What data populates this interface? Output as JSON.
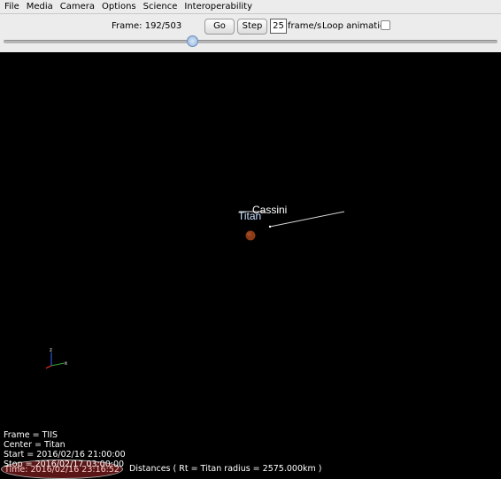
{
  "menu": [
    "File",
    "Media",
    "Camera",
    "Options",
    "Science",
    "Interoperability"
  ],
  "controls": {
    "frame_text": "Frame: 192/503",
    "current_frame": 192,
    "total_frames": 503,
    "go_label": "Go",
    "step_label": "Step",
    "fps_value": "25",
    "fps_label": "frame/s",
    "loop_label": "Loop animation",
    "loop_checked": false
  },
  "scene": {
    "body_label": "Titan",
    "spacecraft_label": "Cassini",
    "body_color": "#8a3a14",
    "axes": {
      "z": "z",
      "x": "x"
    }
  },
  "status": {
    "time_text": "Time: 2016/02/16 23:16:52",
    "distances_text": "Distances ( Rt = Titan radius = 2575.000km )",
    "frame_line": "Frame = TIIS",
    "center_line": "Center = Titan",
    "start_line": "Start = 2016/02/16 21:00:00",
    "stop_line": "Stop = 2016/02/17 03:00:00"
  }
}
